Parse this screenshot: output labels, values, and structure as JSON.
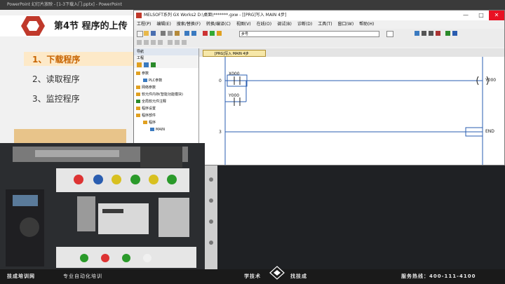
{
  "powerpoint": {
    "titlebar": "PowerPoint 幻灯片放映 - [1-3下载入门.pptx] - PowerPoint",
    "slide_title": "第4节  程序的上传",
    "menu": [
      {
        "label": "1、下载程序",
        "active": true
      },
      {
        "label": "2、读取程序",
        "active": false
      },
      {
        "label": "3、监控程序",
        "active": false
      }
    ]
  },
  "gx": {
    "title": "MELSOFT系列 GX Works2 D:\\桌面\\*******.gxw - [[PRG]写入 MAIN 4步]",
    "window_buttons": [
      "—",
      "□",
      "✕"
    ],
    "menubar": [
      "工程(P)",
      "编辑(E)",
      "搜索/替换(F)",
      "转换/编译(C)",
      "视图(V)",
      "在线(O)",
      "调试(B)",
      "诊断(D)",
      "工具(T)",
      "窗口(W)",
      "帮助(H)"
    ],
    "combo_value": "步号",
    "nav": {
      "header": "导航",
      "subheader": "工程",
      "tree": [
        {
          "label": "参数",
          "level": 0
        },
        {
          "label": "PLC参数",
          "level": 1
        },
        {
          "label": "网络参数",
          "level": 0
        },
        {
          "label": "软元件内存(智能功能模块)",
          "level": 0
        },
        {
          "label": "全局软元件注释",
          "level": 0
        },
        {
          "label": "程序设置",
          "level": 0
        },
        {
          "label": "程序部件",
          "level": 0
        },
        {
          "label": "程序",
          "level": 1
        },
        {
          "label": "MAIN",
          "level": 2
        }
      ]
    },
    "tab_label": "[PRG]写入 MAIN 4步",
    "ladder": {
      "steps": [
        "0",
        "3"
      ],
      "contact_x": "X000",
      "contact_y": "Y000",
      "coil": "Y000",
      "end": "END"
    }
  },
  "footer": {
    "brand": "技成培训网",
    "slogan": "专业自动化培训",
    "left_tag": "学技术",
    "right_tag": "找技成",
    "hotline": "服务热线：400-111-4100"
  },
  "colors": {
    "accent_orange": "#c86400",
    "tab_yellow": "#f6e7a8",
    "ladder_blue": "#2a5db0"
  }
}
